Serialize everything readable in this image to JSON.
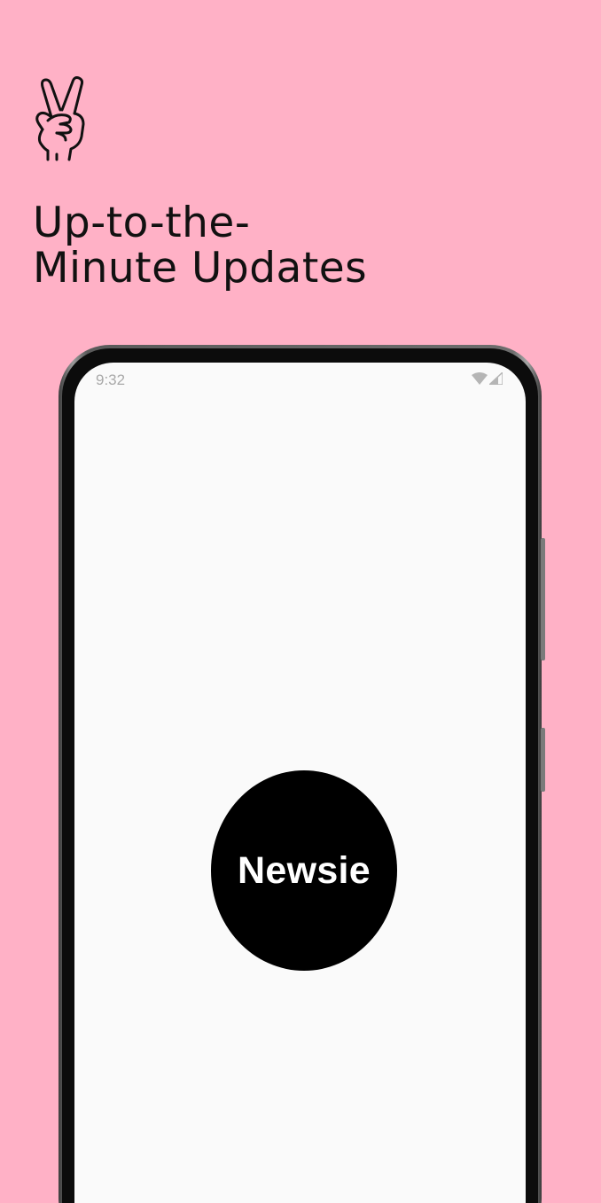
{
  "colors": {
    "background": "#FFB1C6",
    "headline": "#111111",
    "screen": "#FAFAFA",
    "logo_circle": "#000000",
    "logo_text": "#FFFFFF"
  },
  "header": {
    "icon": "peace-hand-icon",
    "headline_line1": "Up-to-the-",
    "headline_line2": "Minute Updates"
  },
  "phone": {
    "status_bar": {
      "time": "9:32",
      "icons": [
        "wifi-icon",
        "signal-icon"
      ]
    },
    "splash": {
      "logo_text": "Newsie"
    }
  }
}
